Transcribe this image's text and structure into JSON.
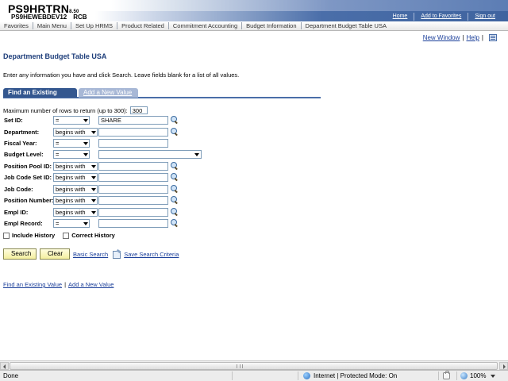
{
  "header": {
    "app_name": "PS9HRTRN",
    "app_version": "8.50",
    "database": "PS9HEWEBDEV12",
    "user_code": "RCB",
    "links": {
      "home": "Home",
      "add_to_favorites": "Add to Favorites",
      "sign_out": "Sign out"
    }
  },
  "menubar": {
    "items": [
      "Favorites",
      "Main Menu",
      "Set Up HRMS",
      "Product Related",
      "Commitment Accounting",
      "Budget Information",
      "Department Budget Table USA"
    ]
  },
  "util": {
    "new_window": "New Window",
    "help": "Help",
    "personalize_icon": "personalize-page-icon"
  },
  "page": {
    "title": "Department Budget Table USA",
    "instructions": "Enter any information you have and click Search. Leave fields blank for a list of all values."
  },
  "tabs": {
    "find_existing": "Find an Existing Value",
    "add_new": "Add a New Value"
  },
  "form": {
    "max_rows_label": "Maximum number of rows to return (up to 300):",
    "max_rows_value": "300",
    "fields": [
      {
        "label": "Set ID:",
        "operator": "=",
        "value": "SHARE"
      },
      {
        "label": "Department:",
        "operator": "begins with",
        "value": ""
      },
      {
        "label": "Fiscal Year:",
        "operator": "=",
        "value": ""
      },
      {
        "label": "Budget Level:",
        "operator": "=",
        "value": ""
      },
      {
        "label": "Position Pool ID:",
        "operator": "begins with",
        "value": ""
      },
      {
        "label": "Job Code Set ID:",
        "operator": "begins with",
        "value": ""
      },
      {
        "label": "Job Code:",
        "operator": "begins with",
        "value": ""
      },
      {
        "label": "Position Number:",
        "operator": "begins with",
        "value": ""
      },
      {
        "label": "Empl ID:",
        "operator": "begins with",
        "value": ""
      },
      {
        "label": "Empl Record:",
        "operator": "=",
        "value": ""
      }
    ],
    "include_history": "Include History",
    "correct_history": "Correct History"
  },
  "actions": {
    "search": "Search",
    "clear": "Clear",
    "basic_search": "Basic Search",
    "save_search": "Save Search Criteria"
  },
  "bottom_links": {
    "find_existing": "Find an Existing Value",
    "add_new": "Add a New Value"
  },
  "status": {
    "done": "Done",
    "zone": "Internet | Protected Mode: On",
    "zoom": "100%"
  }
}
